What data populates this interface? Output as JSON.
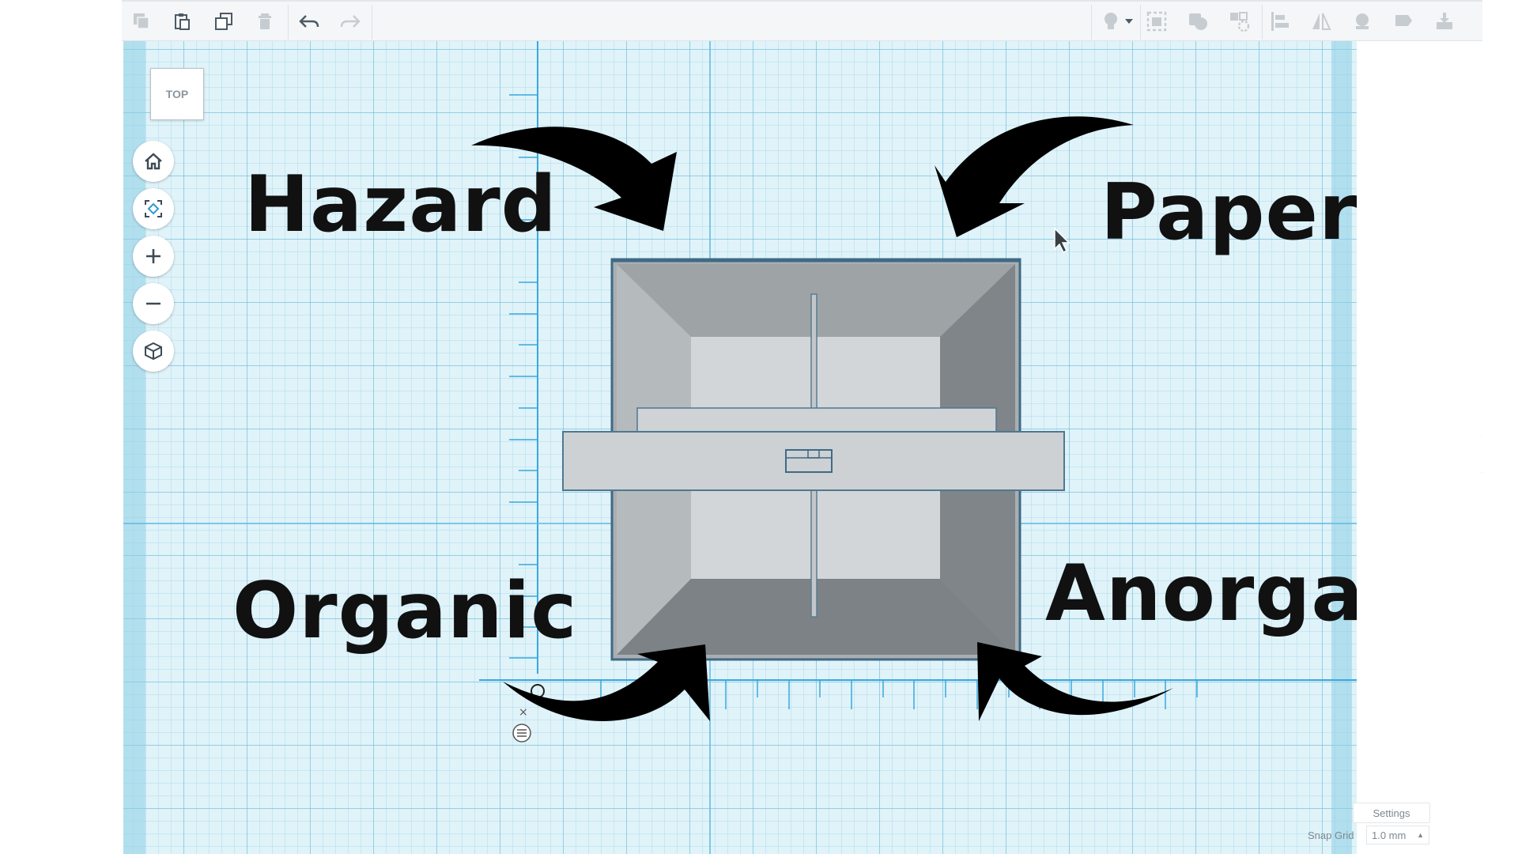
{
  "viewcube": {
    "label": "TOP"
  },
  "toolbar": {
    "icons": [
      "copy-icon",
      "paste-icon",
      "duplicate-icon",
      "delete-icon",
      "undo-icon",
      "redo-icon",
      "light-bulb-icon",
      "dropdown-icon",
      "group-icon",
      "ungroup-icon",
      "workplane-icon",
      "align-icon",
      "mirror-icon",
      "ruler-icon",
      "note-icon",
      "import-icon"
    ]
  },
  "nav": {
    "icons": [
      "home-icon",
      "fit-view-icon",
      "zoom-in-icon",
      "zoom-out-icon",
      "perspective-icon"
    ]
  },
  "labels": {
    "hazard": "Hazard",
    "paper": "Paper",
    "organic": "Organic",
    "anorganic": "Anorganic"
  },
  "footer": {
    "settings": "Settings",
    "snap_grid_label": "Snap Grid",
    "snap_grid_value": "1.0 mm"
  },
  "colors": {
    "grid_bg": "#dff3f9",
    "axis": "#3aa8dd",
    "bin_outer": "#c9ced2",
    "bin_dark": "#7f8588",
    "arrow": "#000000"
  }
}
